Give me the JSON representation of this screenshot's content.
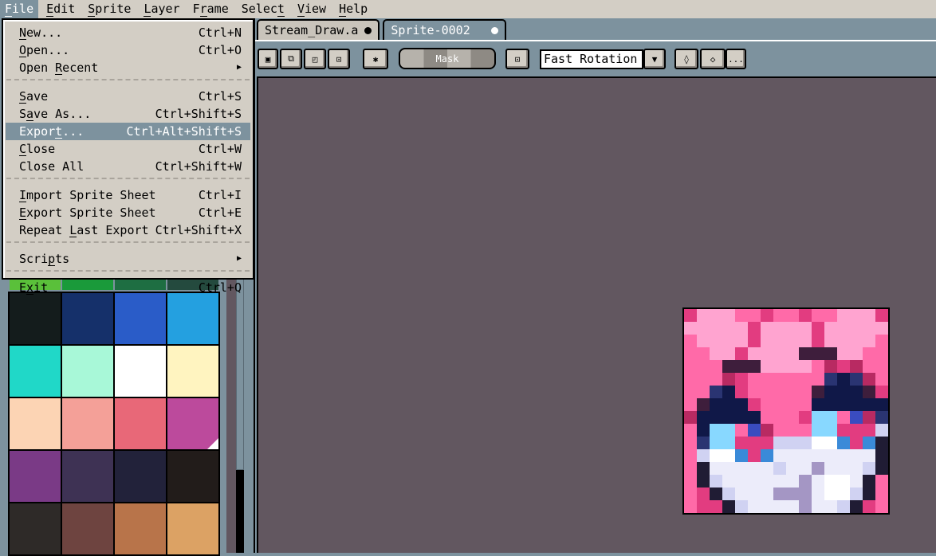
{
  "menubar": [
    {
      "label": "File",
      "m": 0
    },
    {
      "label": "Edit",
      "m": 0
    },
    {
      "label": "Sprite",
      "m": 0
    },
    {
      "label": "Layer",
      "m": 0
    },
    {
      "label": "Frame",
      "m": 1
    },
    {
      "label": "Select",
      "m": 5
    },
    {
      "label": "View",
      "m": 0
    },
    {
      "label": "Help",
      "m": 0
    }
  ],
  "tabs": [
    {
      "label": "Stream_Draw.a"
    },
    {
      "label": "Sprite-0002"
    }
  ],
  "toolbar": {
    "mask_label": "Mask",
    "rotation_value": "Fast Rotation",
    "more_label": "..."
  },
  "file_menu": [
    {
      "label": "New...",
      "m": 0,
      "shortcut": "Ctrl+N"
    },
    {
      "label": "Open...",
      "m": 0,
      "shortcut": "Ctrl+O"
    },
    {
      "label": "Open Recent",
      "m": 5,
      "shortcut": "",
      "submenu": true
    },
    {
      "sep": true
    },
    {
      "label": "Save",
      "m": 0,
      "shortcut": "Ctrl+S"
    },
    {
      "label": "Save As...",
      "m": 1,
      "shortcut": "Ctrl+Shift+S"
    },
    {
      "label": "Export...",
      "m": 5,
      "shortcut": "Ctrl+Alt+Shift+S",
      "highlighted": true
    },
    {
      "label": "Close",
      "m": 0,
      "shortcut": "Ctrl+W"
    },
    {
      "label": "Close All",
      "m": -1,
      "shortcut": "Ctrl+Shift+W"
    },
    {
      "sep": true
    },
    {
      "label": "Import Sprite Sheet",
      "m": 0,
      "shortcut": "Ctrl+I"
    },
    {
      "label": "Export Sprite Sheet",
      "m": 0,
      "shortcut": "Ctrl+E"
    },
    {
      "label": "Repeat Last Export",
      "m": 7,
      "shortcut": "Ctrl+Shift+X"
    },
    {
      "sep": true
    },
    {
      "label": "Scripts",
      "m": 4,
      "shortcut": "",
      "submenu": true
    },
    {
      "sep": true
    },
    {
      "label": "Exit",
      "m": 1,
      "shortcut": "Ctrl+Q"
    }
  ],
  "palette": {
    "top_row": [
      "#5ac03a",
      "#1a9a3a",
      "#1e6e42",
      "#244a3e"
    ],
    "colors": [
      "#141c1c",
      "#15306a",
      "#2a5cc8",
      "#24a0e0",
      "#20d8c8",
      "#a8f8d8",
      "#ffffff",
      "#fff4c0",
      "#fcd4b4",
      "#f4a098",
      "#e86878",
      "#bc4a9c",
      "#7a3a86",
      "#3e3254",
      "#22223a",
      "#221c1a",
      "#2e2a28",
      "#6e4440",
      "#b8744a",
      "#dca264"
    ],
    "selected": 11
  },
  "sprite": {
    "colors": {
      "P": "#ffa4d0",
      "H": "#ff6aa8",
      "M": "#e23c80",
      "D": "#3e1e3c",
      "R": "#b82a62",
      "N": "#101848",
      "B": "#2a3472",
      "C": "#88d8ff",
      "L": "#3a4cc0",
      "S": "#3a8ad8",
      "W": "#ffffff",
      "E": "#ececfa",
      "V": "#d0d2f2",
      "G": "#a496c4",
      "K": "#201c34"
    },
    "rows": [
      "MPPPHHMHHMHHPPPM",
      "PPPPPMPPPPMPPPPP",
      "HPPPPMPPPPMPPPPH",
      "HHPPMPPPPDDDPPHH",
      "HHHDDDPPPPHRMRHH",
      "HHHRMHHHHHHBNBRH",
      "HHBNMHHHHHDNNNDM",
      "HDNNNMHHHHNNNNNN",
      "RNNNNNHHHMCCHLRB",
      "HNCCHLRHHHCCMMMV",
      "HBCCMMMVVVWWSMSK",
      "HVWWSMSEEEEEEEEK",
      "HKEEEEEVEEGEEEVK",
      "HKVEEEEEEGEWWEKH",
      "HMKVEEEGGGEWWVKH",
      "HMMKVEEEEGEEVKMH"
    ]
  }
}
